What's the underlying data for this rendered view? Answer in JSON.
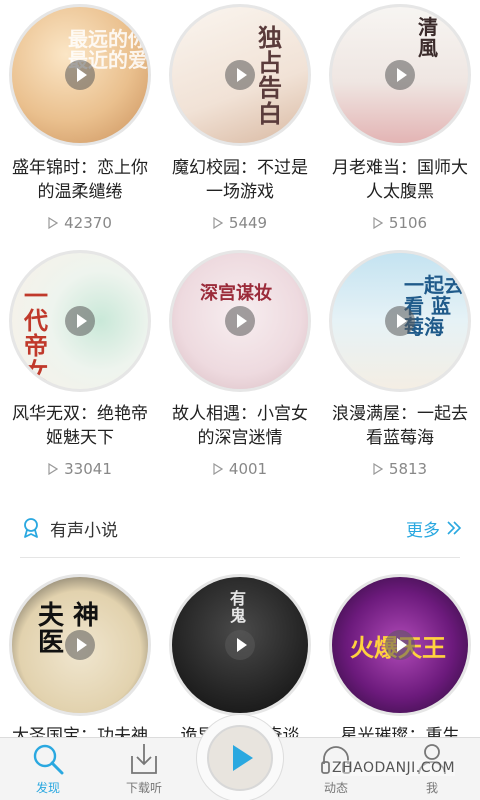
{
  "row1": [
    {
      "title": "盛年锦时：恋上你的温柔缱绻",
      "plays": "42370",
      "cover_text": "最远的你 最近的爱",
      "cover_colors": [
        "#f4d2a6",
        "#d9a56d"
      ]
    },
    {
      "title": "魔幻校园：不过是一场游戏",
      "plays": "5449",
      "cover_text": "独占告白",
      "cover_colors": [
        "#f5ede4",
        "#e3c9b6"
      ]
    },
    {
      "title": "月老难当：国师大人太腹黑",
      "plays": "5106",
      "cover_text": "清風",
      "cover_colors": [
        "#f3f1ee",
        "#e0b6b6"
      ]
    }
  ],
  "row2": [
    {
      "title": "风华无双：绝艳帝姬魅天下",
      "plays": "33041",
      "cover_text": "一代帝女",
      "cover_colors": [
        "#f7f2ea",
        "#b9dcc8"
      ]
    },
    {
      "title": "故人相遇：小宫女的深宫迷情",
      "plays": "4001",
      "cover_text": "深宫谋妆",
      "cover_colors": [
        "#f0e6e8",
        "#d8c0c4"
      ]
    },
    {
      "title": "浪漫满屋：一起去看蓝莓海",
      "plays": "5813",
      "cover_text": "一起去看 蓝莓海",
      "cover_colors": [
        "#bfe0ef",
        "#f3efe6"
      ]
    }
  ],
  "section": {
    "title": "有声小说",
    "more": "更多"
  },
  "row3": [
    {
      "title": "大圣国宝：功夫神医",
      "cover_text": "夫 神 医",
      "cover_colors": [
        "#e9dcc0",
        "#222222"
      ]
    },
    {
      "title": "诡异故事：奇谈",
      "cover_text": "有鬼",
      "cover_colors": [
        "#2e2e2e",
        "#111111"
      ]
    },
    {
      "title": "星光璀璨：重生",
      "cover_text": "火爆天王",
      "cover_colors": [
        "#7a1b86",
        "#2a0d38"
      ]
    }
  ],
  "tabs": [
    {
      "label": "发现",
      "icon": "search-icon"
    },
    {
      "label": "下载听",
      "icon": "download-icon"
    },
    {
      "label": "",
      "icon": "play-icon"
    },
    {
      "label": "动态",
      "icon": "headphones-icon"
    },
    {
      "label": "我",
      "icon": "person-icon"
    }
  ],
  "watermark": "ZHAODANJI.COM",
  "colors": {
    "accent": "#2aa8e0",
    "text": "#222222",
    "muted": "#888888"
  }
}
